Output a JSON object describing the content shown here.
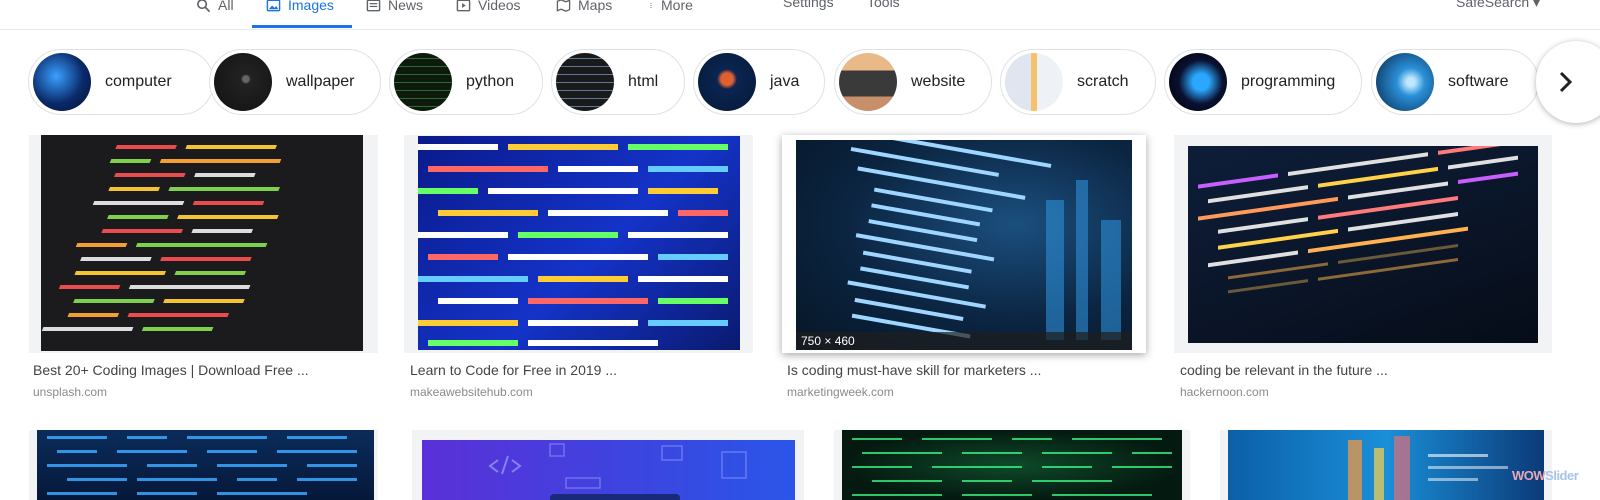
{
  "tabs": [
    {
      "label": "All",
      "icon": "search-icon"
    },
    {
      "label": "Images",
      "icon": "image-icon",
      "active": true
    },
    {
      "label": "News",
      "icon": "news-icon"
    },
    {
      "label": "Videos",
      "icon": "video-icon"
    },
    {
      "label": "Maps",
      "icon": "map-icon"
    },
    {
      "label": "More",
      "icon": "more-vert-icon"
    }
  ],
  "tools": {
    "settings": "Settings",
    "tools": "Tools",
    "safesearch": "SafeSearch ▾"
  },
  "chips": [
    {
      "label": "computer"
    },
    {
      "label": "wallpaper"
    },
    {
      "label": "python"
    },
    {
      "label": "html"
    },
    {
      "label": "java"
    },
    {
      "label": "website"
    },
    {
      "label": "scratch"
    },
    {
      "label": "programming"
    },
    {
      "label": "software"
    }
  ],
  "results": [
    {
      "title": "Best 20+ Coding Images | Download Free ...",
      "source": "unsplash.com"
    },
    {
      "title": "Learn to Code for Free in 2019 ...",
      "source": "makeawebsitehub.com"
    },
    {
      "title": "Is coding must-have skill for marketers ...",
      "source": "marketingweek.com",
      "size": "750 × 460"
    },
    {
      "title": "coding be relevant in the future ...",
      "source": "hackernoon.com"
    }
  ],
  "watermark": {
    "part1": "WOW",
    "part2": "Slider"
  },
  "colors": {
    "accent": "#1a73e8"
  }
}
